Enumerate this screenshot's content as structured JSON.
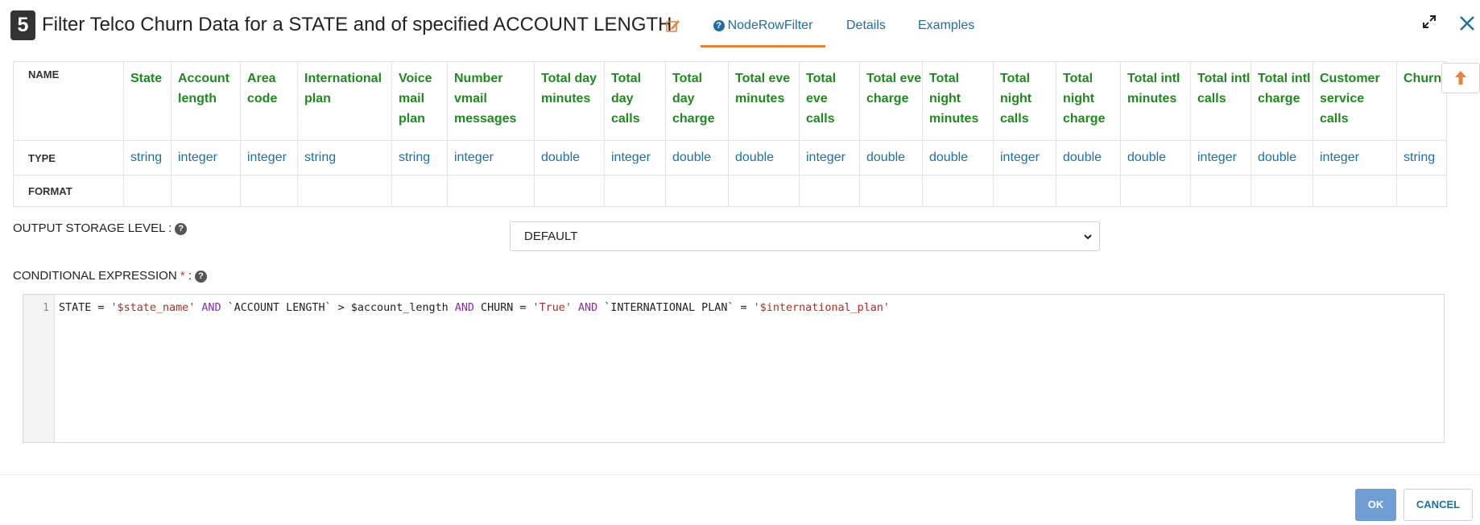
{
  "header": {
    "step_number": "5",
    "title": "Filter Telco Churn Data for a STATE and of specified ACCOUNT LENGTH",
    "tabs": [
      {
        "label": "NodeRowFilter",
        "active": true
      },
      {
        "label": "Details",
        "active": false
      },
      {
        "label": "Examples",
        "active": false
      }
    ]
  },
  "schema_table": {
    "row_labels": {
      "name": "NAME",
      "type": "TYPE",
      "format": "FORMAT"
    },
    "columns": [
      {
        "name": "State",
        "type": "string"
      },
      {
        "name": "Account length",
        "type": "integer"
      },
      {
        "name": "Area code",
        "type": "integer"
      },
      {
        "name": "International plan",
        "type": "string"
      },
      {
        "name": "Voice mail plan",
        "type": "string"
      },
      {
        "name": "Number vmail messages",
        "type": "integer"
      },
      {
        "name": "Total day minutes",
        "type": "double"
      },
      {
        "name": "Total day calls",
        "type": "integer"
      },
      {
        "name": "Total day charge",
        "type": "double"
      },
      {
        "name": "Total eve minutes",
        "type": "double"
      },
      {
        "name": "Total eve calls",
        "type": "integer"
      },
      {
        "name": "Total eve charge",
        "type": "double"
      },
      {
        "name": "Total night minutes",
        "type": "double"
      },
      {
        "name": "Total night calls",
        "type": "integer"
      },
      {
        "name": "Total night charge",
        "type": "double"
      },
      {
        "name": "Total intl minutes",
        "type": "double"
      },
      {
        "name": "Total intl calls",
        "type": "integer"
      },
      {
        "name": "Total intl charge",
        "type": "double"
      },
      {
        "name": "Customer service calls",
        "type": "integer"
      },
      {
        "name": "Churn",
        "type": "string"
      }
    ]
  },
  "output_storage": {
    "label": "OUTPUT STORAGE LEVEL :",
    "selected": "DEFAULT"
  },
  "conditional_expression": {
    "label": "CONDITIONAL EXPRESSION",
    "required_mark": "*",
    "colon": ":",
    "line_number": "1",
    "tokens": [
      {
        "t": "STATE = ",
        "c": ""
      },
      {
        "t": "'$state_name'",
        "c": "str"
      },
      {
        "t": " ",
        "c": ""
      },
      {
        "t": "AND",
        "c": "kw"
      },
      {
        "t": " `ACCOUNT LENGTH` > $account_length ",
        "c": ""
      },
      {
        "t": "AND",
        "c": "kw"
      },
      {
        "t": " CHURN = ",
        "c": ""
      },
      {
        "t": "'True'",
        "c": "str"
      },
      {
        "t": " ",
        "c": ""
      },
      {
        "t": "AND",
        "c": "kw"
      },
      {
        "t": " `INTERNATIONAL PLAN` = ",
        "c": ""
      },
      {
        "t": "'$international_plan'",
        "c": "str"
      }
    ]
  },
  "footer": {
    "ok_label": "OK",
    "cancel_label": "CANCEL"
  },
  "colors": {
    "accent": "#1d6fa5",
    "column_name": "#1e8a1e",
    "tab_underline": "#e8833a",
    "edit_icon": "#e8833a",
    "ok_button": "#6e9ed3"
  },
  "icons": [
    "edit-icon",
    "help-circle-icon",
    "expand-icon",
    "close-icon",
    "arrow-up-icon",
    "chevron-down-icon",
    "question-icon"
  ]
}
